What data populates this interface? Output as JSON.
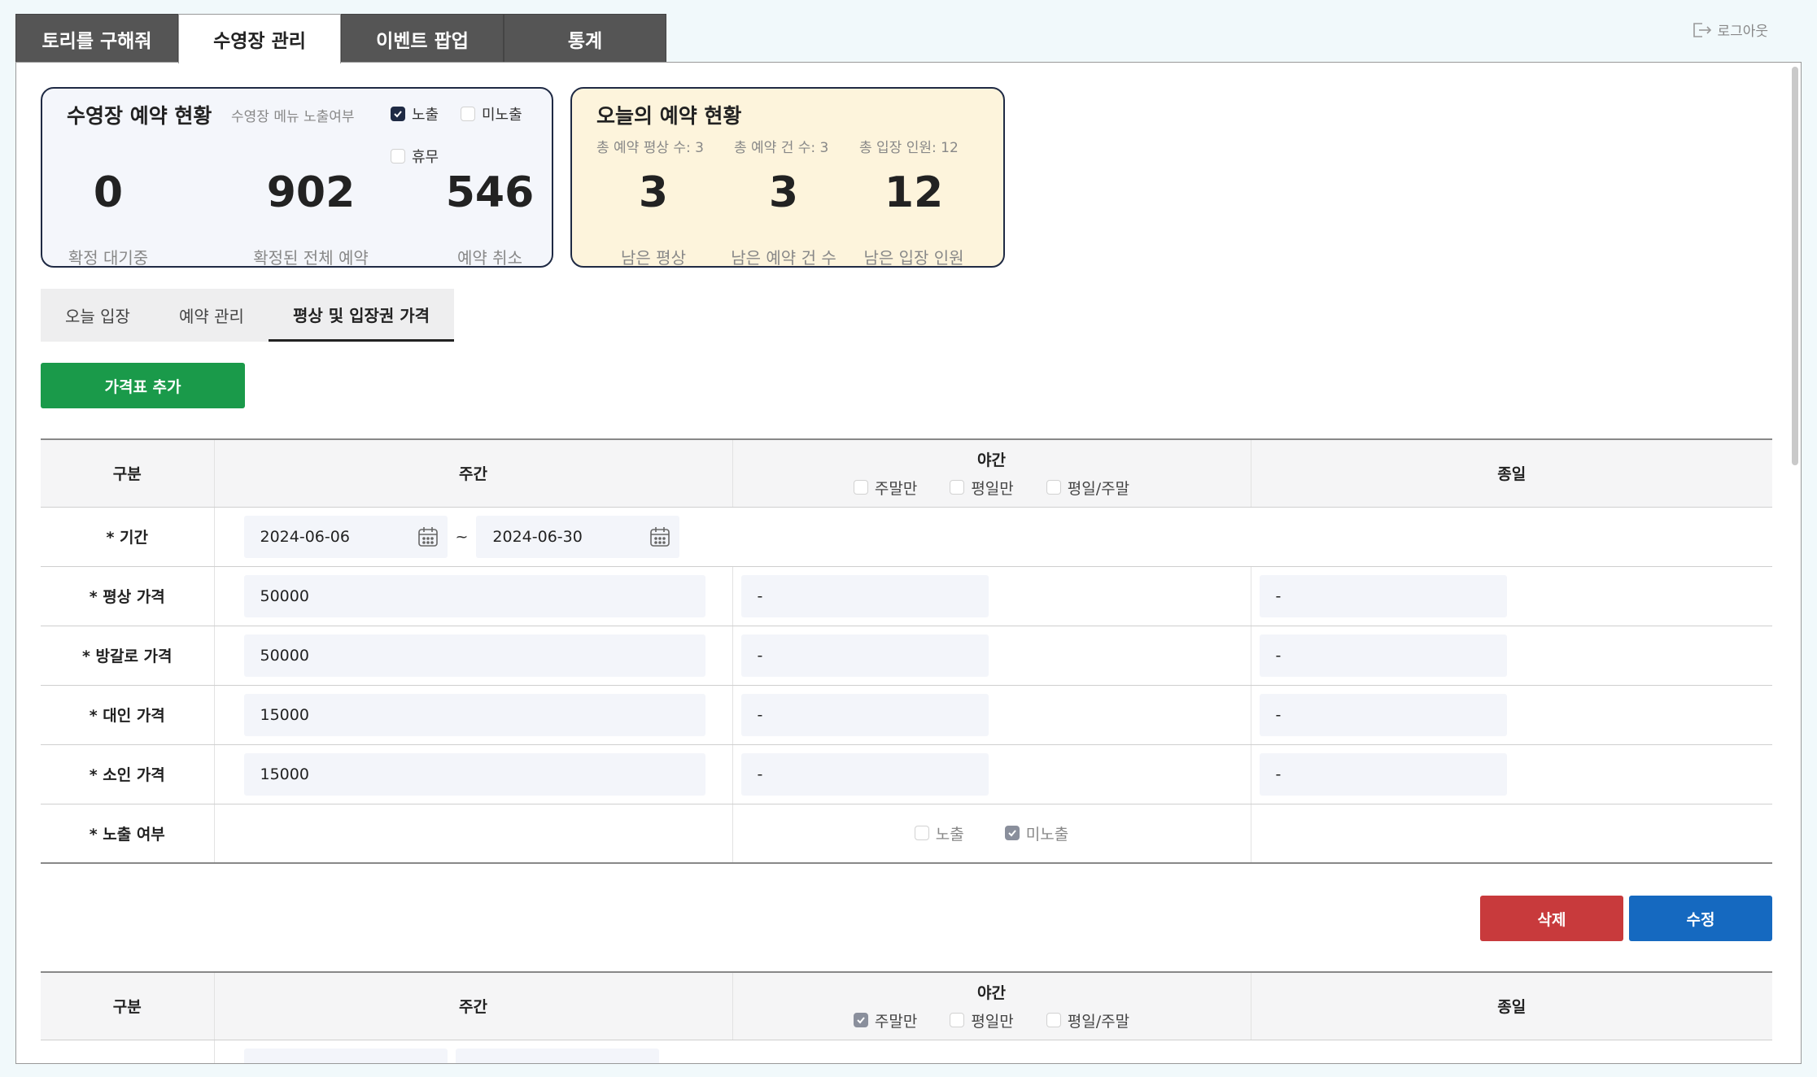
{
  "top_tabs": [
    "토리를 구해줘",
    "수영장 관리",
    "이벤트 팝업",
    "통계"
  ],
  "logout_label": "로그아웃",
  "pool_card": {
    "title": "수영장 예약 현황",
    "menu_label": "수영장 메뉴 노출여부",
    "opt_show": "노출",
    "opt_hide": "미노출",
    "opt_closed": "휴무",
    "stats": [
      {
        "value": "0",
        "label": "확정 대기중"
      },
      {
        "value": "902",
        "label": "확정된 전체 예약"
      },
      {
        "value": "546",
        "label": "예약 취소"
      }
    ]
  },
  "today_card": {
    "title": "오늘의 예약 현황",
    "meta": [
      "총 예약 평상 수: 3",
      "총 예약 건 수: 3",
      "총 입장 인원: 12"
    ],
    "stats": [
      {
        "value": "3",
        "label": "남은 평상"
      },
      {
        "value": "3",
        "label": "남은 예약 건 수"
      },
      {
        "value": "12",
        "label": "남은 입장 인원"
      }
    ]
  },
  "sub_tabs": [
    "오늘 입장",
    "예약 관리",
    "평상 및 입장권 가격"
  ],
  "add_button": "가격표 추가",
  "table": {
    "headers": {
      "category": "구분",
      "day": "주간",
      "night": "야간",
      "allday": "종일"
    },
    "night_options": [
      "주말만",
      "평일만",
      "평일/주말"
    ],
    "period_label": "* 기간",
    "date_from": "2024-06-06",
    "date_tilde": "~",
    "date_to": "2024-06-30",
    "rows": [
      {
        "label": "* 평상 가격",
        "day": "50000",
        "night": "-",
        "allday": "-"
      },
      {
        "label": "* 방갈로 가격",
        "day": "50000",
        "night": "-",
        "allday": "-"
      },
      {
        "label": "* 대인 가격",
        "day": "15000",
        "night": "-",
        "allday": "-"
      },
      {
        "label": "* 소인 가격",
        "day": "15000",
        "night": "-",
        "allday": "-"
      }
    ],
    "expose_label": "* 노출 여부",
    "expose_show": "노출",
    "expose_hide": "미노출"
  },
  "delete_button": "삭제",
  "edit_button": "수정"
}
